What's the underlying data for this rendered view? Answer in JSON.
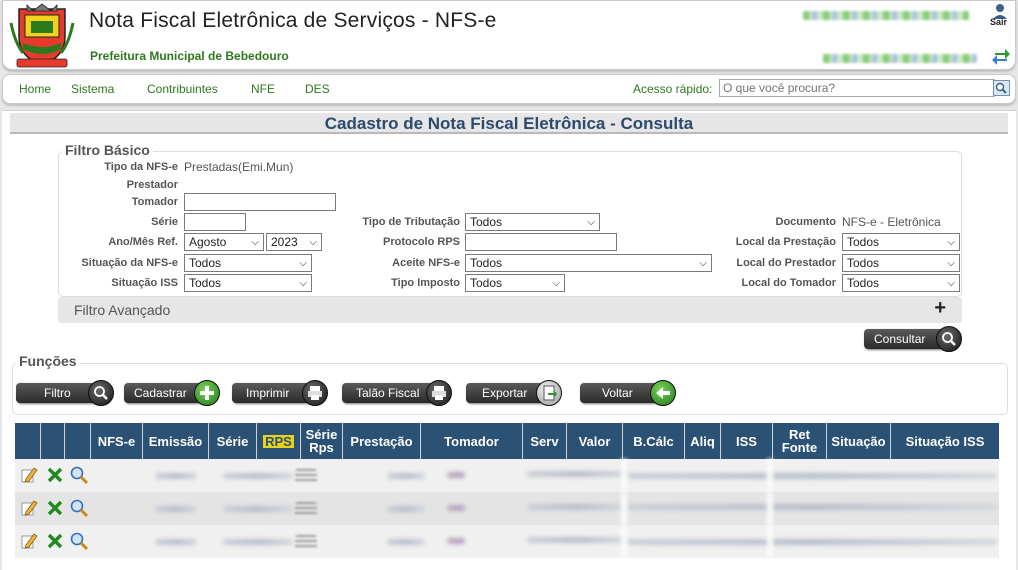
{
  "header": {
    "title": "Nota Fiscal Eletrônica de Serviços - NFS-e",
    "org": "Prefeitura Municipal de Bebedouro",
    "sair_label": "Sair",
    "crest_icon": "city-crest-icon",
    "accent": "#2d7a1e"
  },
  "menu": {
    "items": [
      {
        "label": "Home"
      },
      {
        "label": "Sistema"
      },
      {
        "label": "Contribuintes"
      },
      {
        "label": "NFE"
      },
      {
        "label": "DES"
      }
    ],
    "quick_label": "Acesso rápido:",
    "quick_placeholder": "O que você procura?"
  },
  "page": {
    "title": "Cadastro de Nota Fiscal Eletrônica - Consulta"
  },
  "filter": {
    "legend": "Filtro Básico",
    "tipo_nfse": {
      "label": "Tipo da NFS-e",
      "value": "Prestadas(Emi.Mun)"
    },
    "prestador": {
      "label": "Prestador"
    },
    "tomador": {
      "label": "Tomador",
      "value": ""
    },
    "serie": {
      "label": "Série",
      "value": ""
    },
    "ano_mes": {
      "label": "Ano/Mês Ref.",
      "month": "Agosto",
      "year": "2023"
    },
    "situacao_nfse": {
      "label": "Situação da NFS-e",
      "value": "Todos"
    },
    "situacao_iss": {
      "label": "Situação ISS",
      "value": "Todos"
    },
    "tipo_tributacao": {
      "label": "Tipo de Tributação",
      "value": "Todos"
    },
    "protocolo_rps": {
      "label": "Protocolo RPS",
      "value": ""
    },
    "aceite_nfse": {
      "label": "Aceite NFS-e",
      "value": "Todos"
    },
    "tipo_imposto": {
      "label": "Tipo Imposto",
      "value": "Todos"
    },
    "documento": {
      "label": "Documento",
      "value": "NFS-e - Eletrônica"
    },
    "local_prestacao": {
      "label": "Local da Prestação",
      "value": "Todos"
    },
    "local_prestador": {
      "label": "Local do Prestador",
      "value": "Todos"
    },
    "local_tomador": {
      "label": "Local do Tomador",
      "value": "Todos"
    },
    "advanced": "Filtro Avançado",
    "advanced_toggle": "+",
    "consultar": "Consultar"
  },
  "functions": {
    "legend": "Funções",
    "buttons": {
      "filtro": "Filtro",
      "cadastrar": "Cadastrar",
      "imprimir": "Imprimir",
      "talao": "Talão Fiscal",
      "exportar": "Exportar",
      "voltar": "Voltar"
    }
  },
  "table": {
    "headers": {
      "nfse": "NFS-e",
      "emissao": "Emissão",
      "serie": "Série",
      "rps": "RPS",
      "serie_rps": "Série Rps",
      "prestacao": "Prestação",
      "tomador": "Tomador",
      "serv": "Serv",
      "valor": "Valor",
      "bcalc": "B.Cálc",
      "aliq": "Aliq",
      "iss": "ISS",
      "ret_fonte": "Ret Fonte",
      "situacao": "Situação",
      "situacao_iss": "Situação ISS"
    },
    "row_icons": [
      "edit-pencil-icon",
      "delete-x-icon",
      "view-magnifier-icon"
    ],
    "header_color": "#2b5175",
    "highlight_color": "#e7d31a"
  }
}
